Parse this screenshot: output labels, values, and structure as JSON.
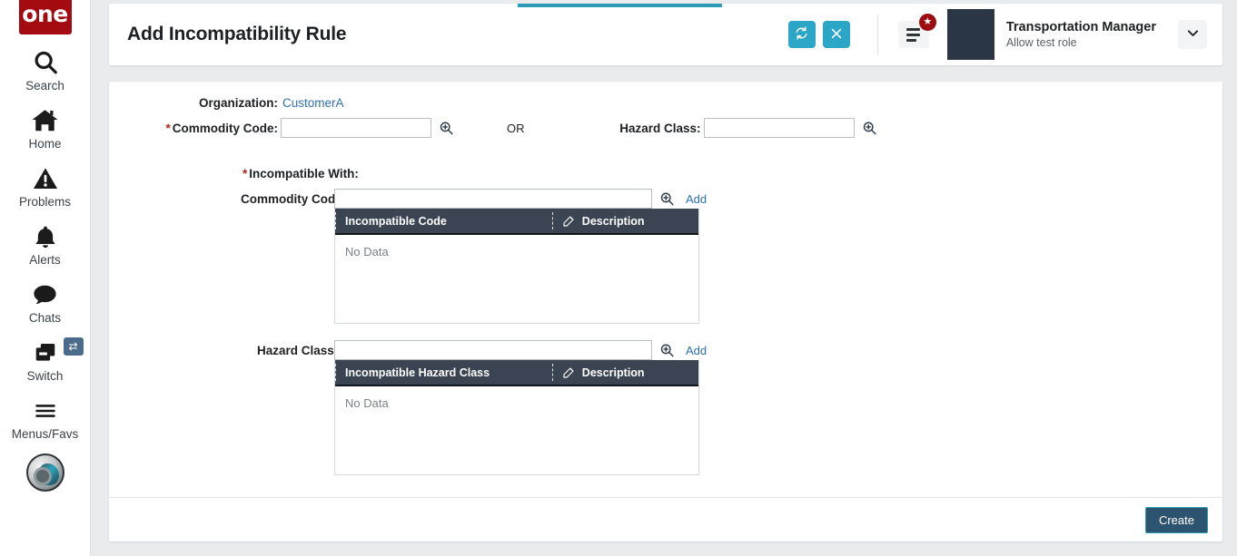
{
  "sidebar": {
    "brand": "one",
    "items": [
      {
        "label": "Search",
        "icon": "search-icon"
      },
      {
        "label": "Home",
        "icon": "home-icon"
      },
      {
        "label": "Problems",
        "icon": "warning-triangle-icon"
      },
      {
        "label": "Alerts",
        "icon": "bell-icon"
      },
      {
        "label": "Chats",
        "icon": "chat-bubble-icon"
      },
      {
        "label": "Switch",
        "icon": "windows-stack-icon",
        "badge": "⇄"
      },
      {
        "label": "Menus/Favs",
        "icon": "hamburger-icon"
      }
    ],
    "avatar": "user-avatar"
  },
  "header": {
    "title": "Add Incompatibility Rule",
    "refresh_label": "⟳",
    "close_label": "✕",
    "menu_badge": "★",
    "user_name": "Transportation Manager",
    "user_role": "Allow test role",
    "caret_label": "⌄",
    "accent_color": "#2b9cb8",
    "button_color": "#2ba6c6"
  },
  "form": {
    "organization_label": "Organization:",
    "organization_value": "CustomerA",
    "commodity_code_label": "Commodity Code:",
    "commodity_code_value": "",
    "or_label": "OR",
    "hazard_class_label": "Hazard Class:",
    "hazard_class_value": "",
    "incompatible_with_label": "Incompatible With:",
    "required_marker": "*",
    "search_icon": "zoom-in-icon"
  },
  "commodity_codes": {
    "label": "Commodity Codes:",
    "value": "",
    "add_label": "Add",
    "columns": [
      "Incompatible Code",
      "Description"
    ],
    "empty_text": "No Data",
    "rows": []
  },
  "hazard_classes": {
    "label": "Hazard Classes:",
    "value": "",
    "add_label": "Add",
    "columns": [
      "Incompatible Hazard Class",
      "Description"
    ],
    "empty_text": "No Data",
    "rows": []
  },
  "footer": {
    "create_label": "Create"
  }
}
